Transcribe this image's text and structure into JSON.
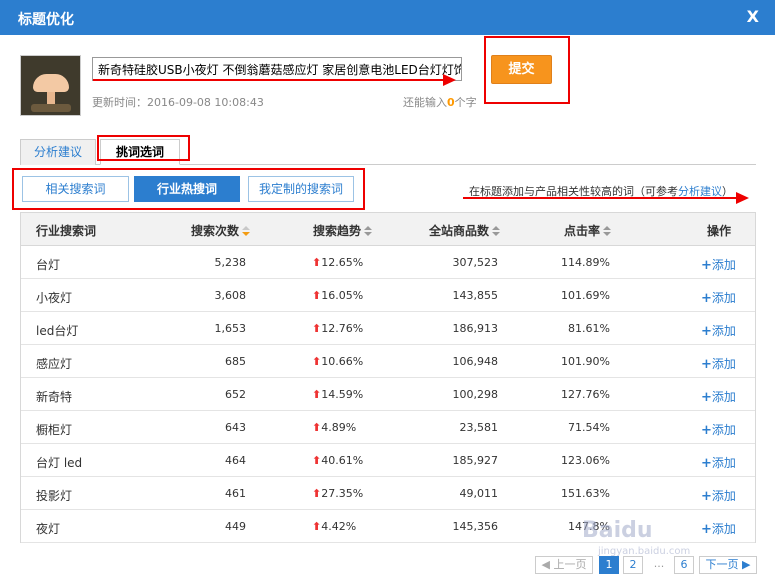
{
  "dialog": {
    "title": "标题优化",
    "close_label": "X"
  },
  "product": {
    "title_value": "新奇特硅胶USB小夜灯 不倒翁蘑菇感应灯 家居创意电池LED台灯灯饰",
    "updated_label": "更新时间：",
    "updated_time": "2016-09-08 10:08:43",
    "remain_prefix": "还能输入",
    "remain_count": "0",
    "remain_suffix": "个字",
    "submit_label": "提交"
  },
  "tabs": [
    {
      "label": "分析建议",
      "active": false
    },
    {
      "label": "挑词选词",
      "active": true
    }
  ],
  "subtabs": [
    {
      "label": "相关搜索词",
      "active": false
    },
    {
      "label": "行业热搜词",
      "active": true
    },
    {
      "label": "我定制的搜索词",
      "active": false
    }
  ],
  "hint": {
    "prefix": "在标题添加与产品相关性较高的词（可参考",
    "link": "分析建议",
    "suffix": "）"
  },
  "table": {
    "columns": [
      "行业搜索词",
      "搜索次数",
      "搜索趋势",
      "全站商品数",
      "点击率",
      "操作"
    ],
    "add_label": "添加",
    "rows": [
      {
        "keyword": "台灯",
        "count": "5,238",
        "trend": "12.65%",
        "goods": "307,523",
        "ctr": "114.89%"
      },
      {
        "keyword": "小夜灯",
        "count": "3,608",
        "trend": "16.05%",
        "goods": "143,855",
        "ctr": "101.69%"
      },
      {
        "keyword": "led台灯",
        "count": "1,653",
        "trend": "12.76%",
        "goods": "186,913",
        "ctr": "81.61%"
      },
      {
        "keyword": "感应灯",
        "count": "685",
        "trend": "10.66%",
        "goods": "106,948",
        "ctr": "101.90%"
      },
      {
        "keyword": "新奇特",
        "count": "652",
        "trend": "14.59%",
        "goods": "100,298",
        "ctr": "127.76%"
      },
      {
        "keyword": "橱柜灯",
        "count": "643",
        "trend": "4.89%",
        "goods": "23,581",
        "ctr": "71.54%"
      },
      {
        "keyword": "台灯 led",
        "count": "464",
        "trend": "40.61%",
        "goods": "185,927",
        "ctr": "123.06%"
      },
      {
        "keyword": "投影灯",
        "count": "461",
        "trend": "27.35%",
        "goods": "49,011",
        "ctr": "151.63%"
      },
      {
        "keyword": "夜灯",
        "count": "449",
        "trend": "4.42%",
        "goods": "145,356",
        "ctr": "147.8%"
      }
    ]
  },
  "pager": {
    "prev": "上一页",
    "pages": [
      "1",
      "2",
      "6"
    ],
    "ellipsis": "...",
    "next": "下一页",
    "current": "1"
  },
  "watermark": {
    "text": "Baidu",
    "sub": "jingyan.baidu.com"
  },
  "colors": {
    "header_blue": "#2c7ecf",
    "submit_orange": "#f7941d",
    "annotation_red": "#e00",
    "trend_up_red": "#e33"
  }
}
